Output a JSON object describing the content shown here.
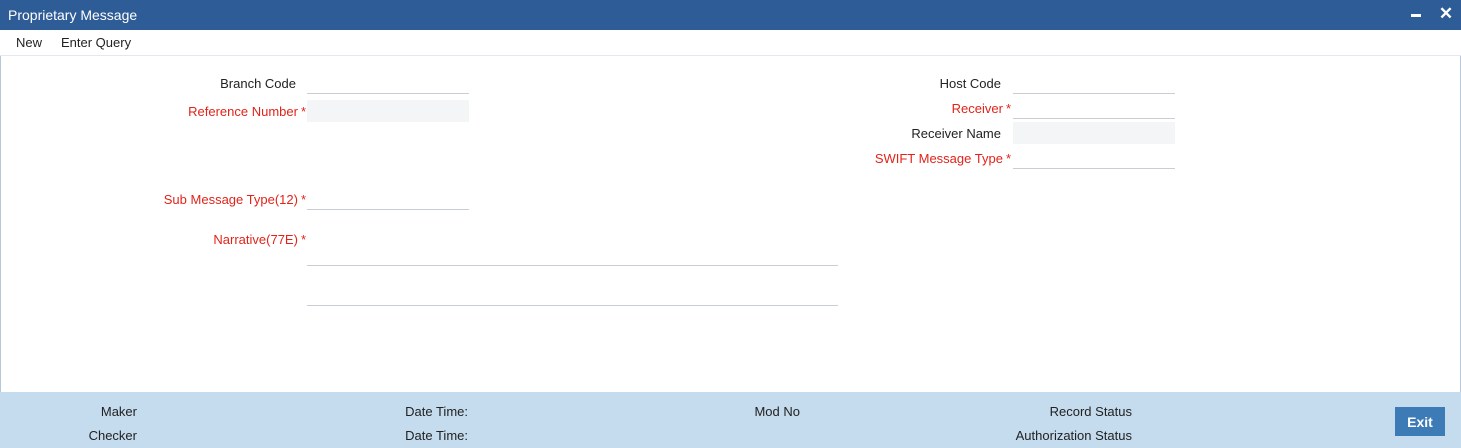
{
  "window": {
    "title": "Proprietary Message",
    "minimize_icon": "minimize-icon",
    "close_icon": "close-icon"
  },
  "menu": {
    "new_label": "New",
    "enter_query_label": "Enter Query"
  },
  "form": {
    "branch_code": {
      "label": "Branch Code",
      "value": ""
    },
    "reference_number": {
      "label": "Reference Number",
      "required": "*",
      "value": ""
    },
    "sub_message_type": {
      "label": "Sub Message Type(12)",
      "required": "*",
      "value": ""
    },
    "narrative": {
      "label": "Narrative(77E)",
      "required": "*",
      "line1": "",
      "line2": ""
    },
    "host_code": {
      "label": "Host Code",
      "value": ""
    },
    "receiver": {
      "label": "Receiver",
      "required": "*",
      "value": ""
    },
    "receiver_name": {
      "label": "Receiver Name",
      "value": ""
    },
    "swift_message_type": {
      "label": "SWIFT Message Type",
      "required": "*",
      "value": ""
    }
  },
  "footer": {
    "maker_label": "Maker",
    "checker_label": "Checker",
    "date_time_label_1": "Date Time:",
    "date_time_label_2": "Date Time:",
    "mod_no_label": "Mod No",
    "record_status_label": "Record Status",
    "authorization_status_label": "Authorization Status",
    "exit_label": "Exit"
  },
  "colors": {
    "titlebar": "#2e5c96",
    "required_text": "#e2231a",
    "footer_bg": "#c5dbee",
    "exit_button": "#3d7bb6"
  }
}
